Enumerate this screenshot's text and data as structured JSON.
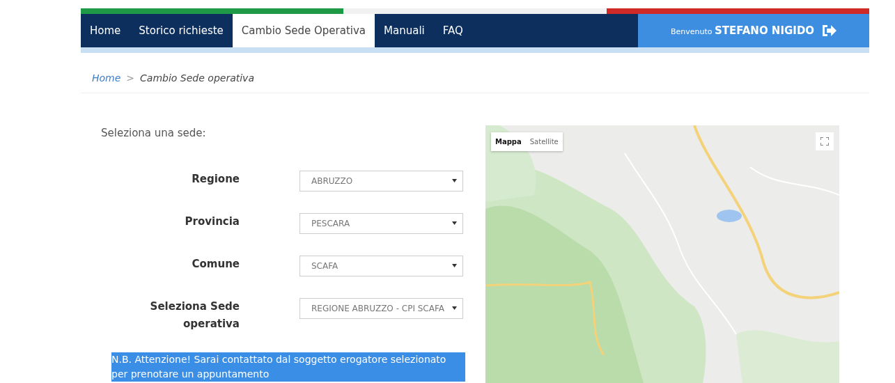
{
  "nav": {
    "items": [
      {
        "label": "Home",
        "selected": false
      },
      {
        "label": "Storico richieste",
        "selected": false
      },
      {
        "label": "Cambio Sede Operativa",
        "selected": true
      },
      {
        "label": "Manuali",
        "selected": false
      },
      {
        "label": "FAQ",
        "selected": false
      }
    ],
    "user": {
      "greeting": "Benvenuto",
      "name": "STEFANO NIGIDO"
    }
  },
  "breadcrumb": [
    {
      "label": "Home",
      "kind": "link"
    },
    {
      "label": ">",
      "kind": "separator"
    },
    {
      "label": "Cambio Sede operativa",
      "kind": "current"
    }
  ],
  "form": {
    "title": "Seleziona una sede:",
    "fields": [
      {
        "label": "Regione",
        "value": "ABRUZZO"
      },
      {
        "label": "Provincia",
        "value": "PESCARA"
      },
      {
        "label": "Comune",
        "value": "SCAFA"
      },
      {
        "label": "Seleziona Sede operativa",
        "value": "REGIONE ABRUZZO - CPI SCAFA"
      }
    ],
    "note": "N.B. Attenzione! Sarai contattato dal soggetto erogatore selezionato per prenotare un appuntamento"
  },
  "map": {
    "kind": "picture",
    "map_types": [
      {
        "label": "Mappa",
        "selected": true
      },
      {
        "label": "Satellite",
        "selected": false
      }
    ]
  }
}
